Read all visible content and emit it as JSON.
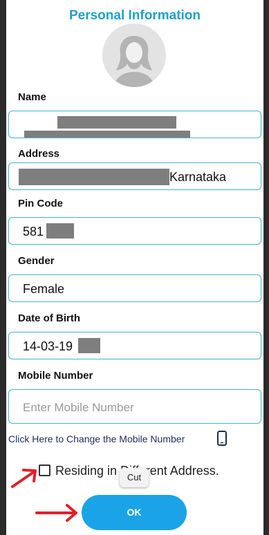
{
  "dialog": {
    "title": "Personal Information",
    "ok_label": "OK"
  },
  "fields": {
    "name": {
      "label": "Name",
      "value": ""
    },
    "address": {
      "label": "Address",
      "value": "Karnataka"
    },
    "pin_code": {
      "label": "Pin Code",
      "value": "581"
    },
    "gender": {
      "label": "Gender",
      "value": "Female"
    },
    "dob": {
      "label": "Date of Birth",
      "value": "14-03-19"
    },
    "mobile": {
      "label": "Mobile Number",
      "placeholder": "Enter Mobile Number"
    }
  },
  "change_mobile_link": "Click Here to Change the Mobile Number",
  "residing_checkbox": {
    "label": "Residing in Different Address.",
    "checked": false
  },
  "context_menu": {
    "cut_label": "Cut"
  },
  "colors": {
    "title": "#1fa0c8",
    "field_border": "#3fb6c9",
    "ok_button": "#1aa3e6",
    "annotation_arrow": "#e0202a"
  },
  "icons": {
    "avatar": "avatar-icon",
    "phone": "phone-icon",
    "arrows": "annotation-arrow-icon"
  }
}
